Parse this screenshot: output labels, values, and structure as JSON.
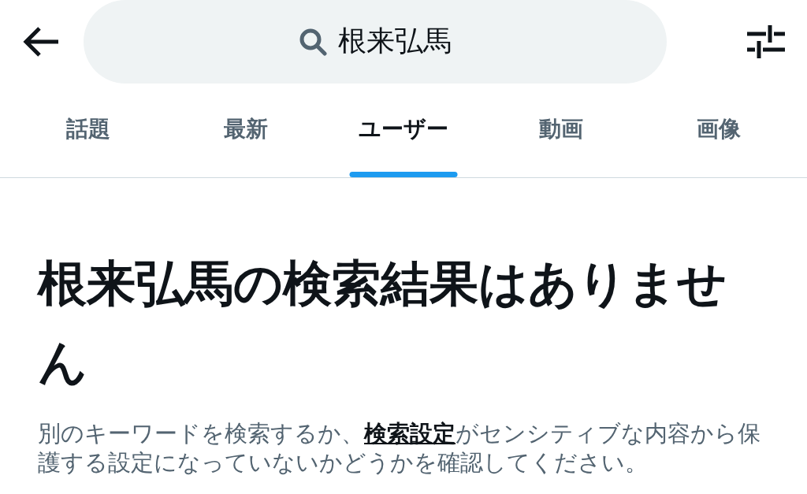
{
  "search": {
    "value": "根来弘馬"
  },
  "tabs": [
    {
      "label": "話題",
      "selected": false
    },
    {
      "label": "最新",
      "selected": false
    },
    {
      "label": "ユーザー",
      "selected": true
    },
    {
      "label": "動画",
      "selected": false
    },
    {
      "label": "画像",
      "selected": false
    }
  ],
  "empty_state": {
    "heading": "根来弘馬の検索結果はありません",
    "message": {
      "before": "別のキーワードを検索するか、",
      "link": "検索設定",
      "after": "がセンシティブな内容から保護する設定になっていないかどうかを確認してください。"
    }
  }
}
